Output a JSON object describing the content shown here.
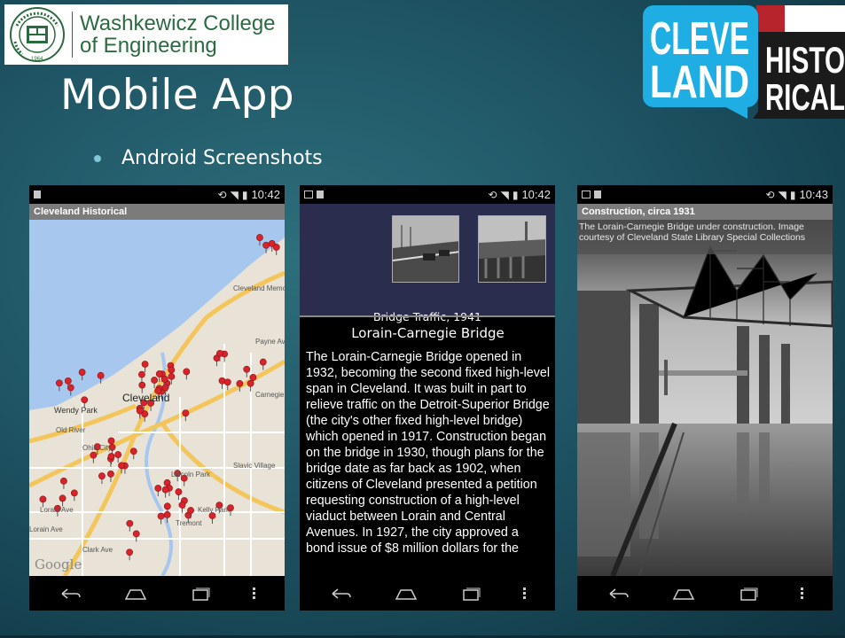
{
  "college": {
    "name_line1": "Washkewicz College",
    "name_line2": "of Engineering",
    "seal_text_top": "STATE UNIVERSITY",
    "seal_text_left": "CLEVELAND",
    "seal_year": "1964"
  },
  "slide": {
    "title": "Mobile App",
    "bullet": "Android Screenshots"
  },
  "brand_logo": {
    "line1": "CLEVE",
    "line2": "LAND",
    "line3": "HISTO",
    "line4": "RICAL",
    "colors": {
      "blue": "#1eaee4",
      "red": "#b8242b",
      "dark": "#1b1b1b"
    }
  },
  "phone1": {
    "time": "10:42",
    "app_title": "Cleveland Historical",
    "google_label": "Google",
    "map_labels": [
      "Cleveland",
      "Wendy Park",
      "Old River",
      "Lorain Ave",
      "Clark Ave",
      "Tremont",
      "Payne Ave",
      "Carnegie",
      "Cleveland Memorial",
      "Slavic Village",
      "Lincoln Park",
      "Ohio City",
      "Kelly Park",
      "Lorain Ave"
    ]
  },
  "phone2": {
    "time": "10:42",
    "caption": "Bridge Traffic, 1941",
    "article_title": "Lorain-Carnegie Bridge",
    "article_body": "The Lorain-Carnegie Bridge opened in 1932, becoming the second fixed high-level span in Cleveland. It was built in part to relieve traffic on the Detroit-Superior Bridge (the city's other fixed high-level bridge) which opened in 1917. Construction began on the bridge in 1930, though plans for the bridge date as far back as 1902, when citizens of Cleveland presented a petition requesting construction of a high-level viaduct between Lorain and Central Avenues. In 1927, the city approved a bond issue of $8 million dollars for the"
  },
  "phone3": {
    "time": "10:43",
    "app_title": "Construction, circa 1931",
    "photo_caption": "The Lorain-Carnegie Bridge under construction. Image courtesy of Cleveland State Library Special Collections"
  }
}
